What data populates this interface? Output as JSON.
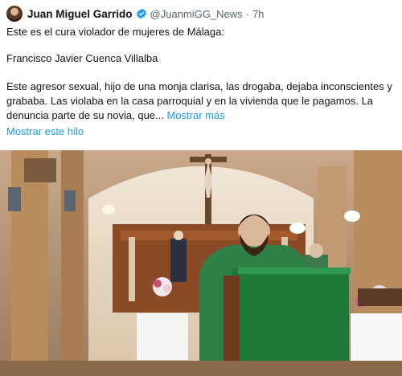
{
  "tweet": {
    "author_name": "Juan Miguel Garrido",
    "author_handle": "@JuanmiGG_News",
    "separator": "·",
    "time": "7h",
    "line1": "Este es el cura violador de mujeres de Málaga:",
    "line2": "Francisco Javier Cuenca Villalba",
    "line3": "Este agresor sexual, hijo de una monja clarisa, las drogaba, dejaba inconscientes y grababa. Las violaba en la casa parroquial y en la vivienda que le pagamos. La denuncia parte de su novia, que...",
    "show_more": "Mostrar más",
    "show_thread": "Mostrar este hilo",
    "verified_color": "#1d9bf0",
    "link_color": "#1d9bf0"
  }
}
